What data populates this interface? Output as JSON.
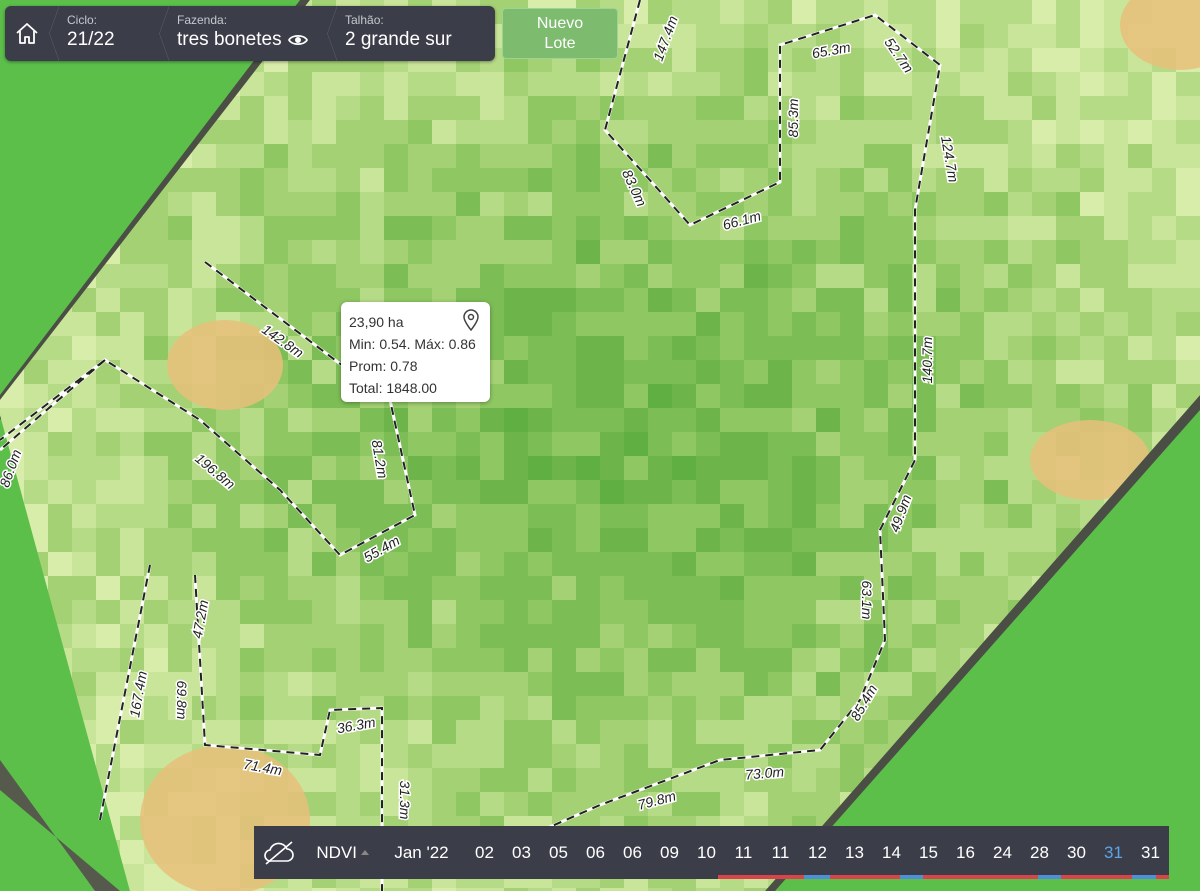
{
  "header": {
    "ciclo": {
      "label": "Ciclo:",
      "value": "21/22"
    },
    "fazenda": {
      "label": "Fazenda:",
      "value": "tres bonetes"
    },
    "talhao": {
      "label": "Talhão:",
      "value": "2 grande sur"
    }
  },
  "nuevo_button": {
    "line1": "Nuevo",
    "line2": "Lote"
  },
  "tooltip": {
    "area": "23,90 ha",
    "minmax": "Min: 0.54. Máx: 0.86",
    "prom": "Prom: 0.78",
    "total": "Total: 1848.00"
  },
  "map": {
    "distance_labels": [
      "147.4m",
      "65.3m",
      "52.7m",
      "85.3m",
      "124.7m",
      "83.0m",
      "66.1m",
      "142.8m",
      "140.7m",
      "81.2m",
      "196.8m",
      "55.4m",
      "86.0m",
      "49.9m",
      "63.1m",
      "47.2m",
      "167.4m",
      "69.8m",
      "36.3m",
      "85.4m",
      "71.4m",
      "73.0m",
      "79.8m",
      "31.3m"
    ]
  },
  "timeline": {
    "layer": "NDVI",
    "month": "Jan '22",
    "days": [
      "02",
      "03",
      "05",
      "06",
      "06",
      "09",
      "10",
      "11",
      "11",
      "12",
      "13",
      "14",
      "15",
      "16",
      "24",
      "28",
      "30",
      "31",
      "31"
    ],
    "active_index": 17
  },
  "colors": {
    "panel": "#3b3d49",
    "accent_blue": "#5aa6e6",
    "bar_red": "#d9434b",
    "button_green": "#7dbb6f"
  }
}
